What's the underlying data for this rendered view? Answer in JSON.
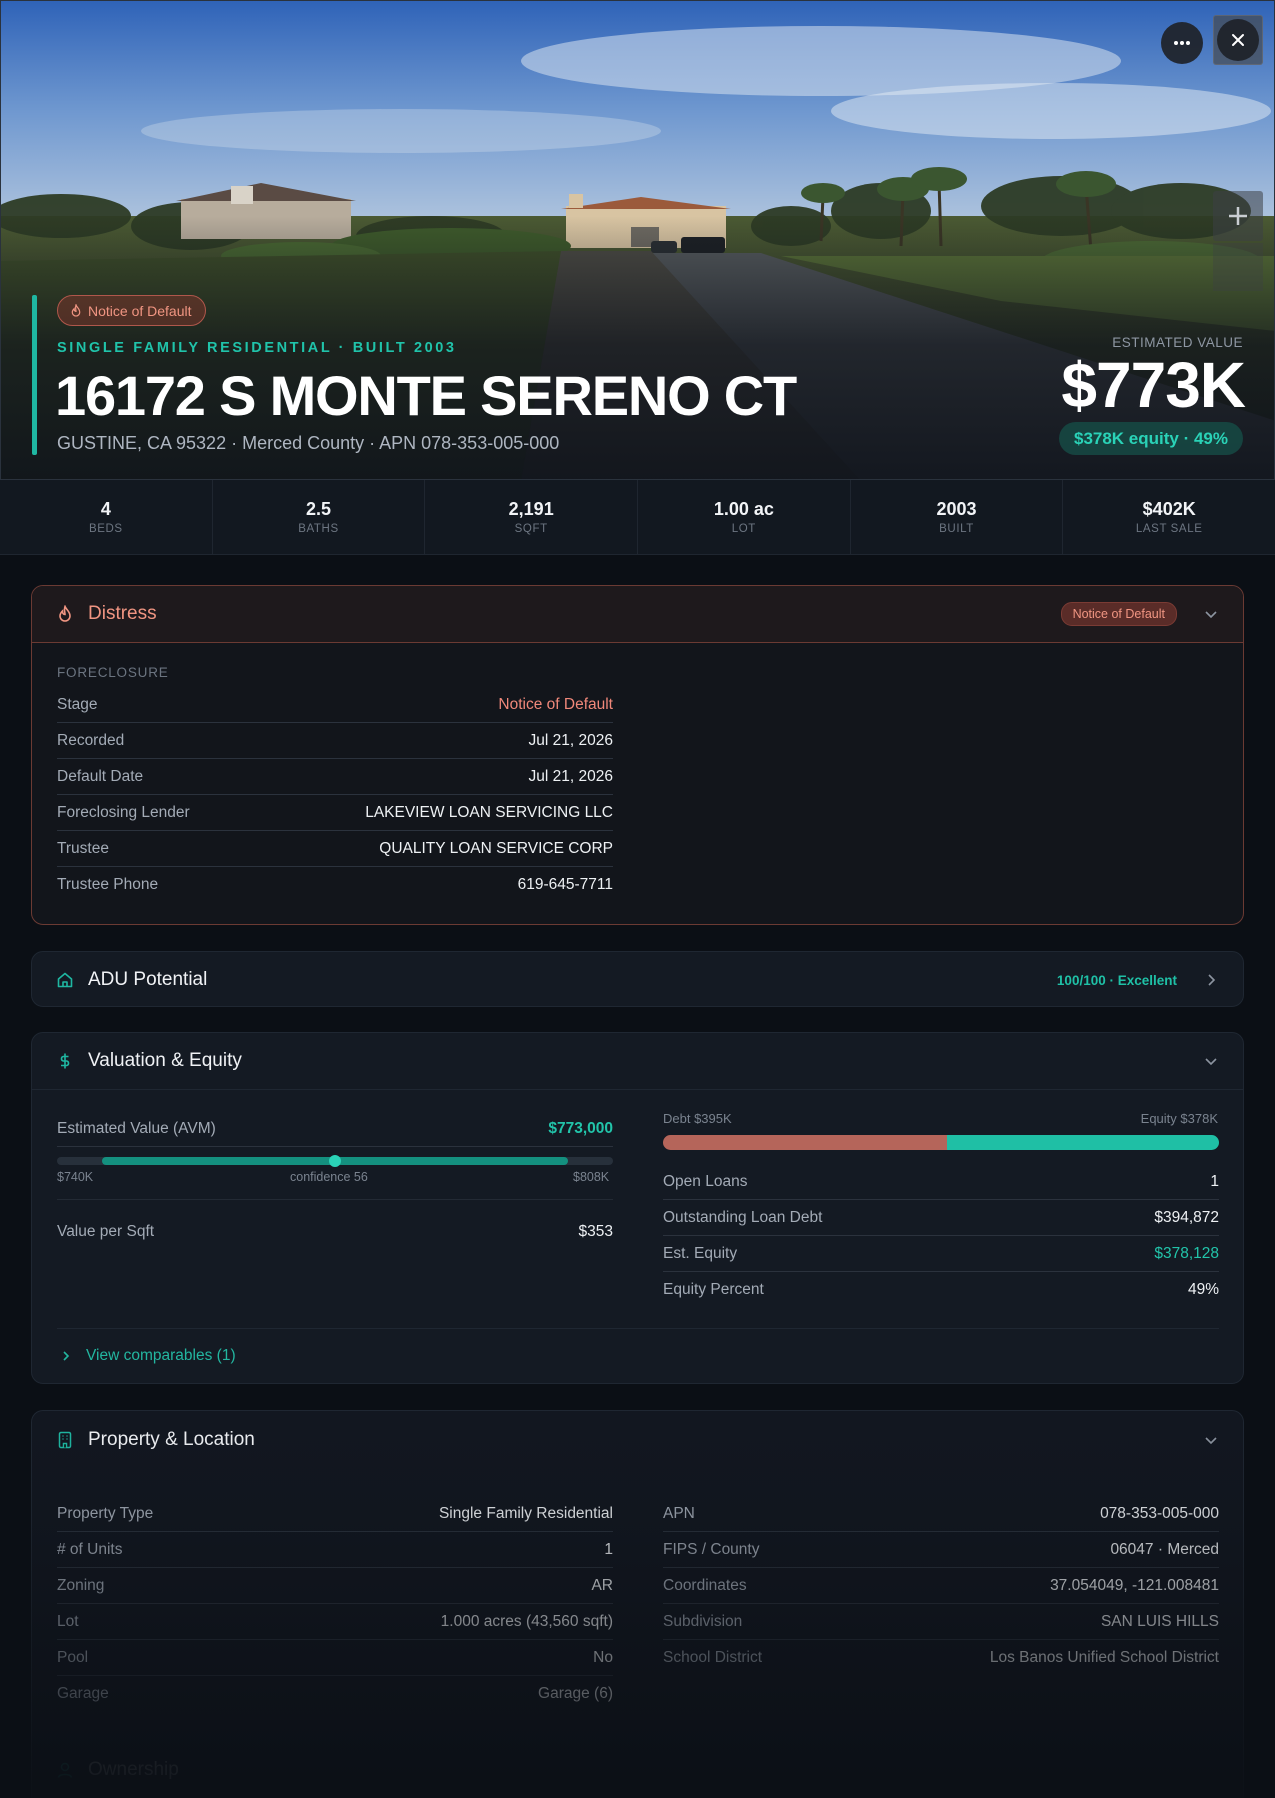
{
  "hero": {
    "badge": "Notice of Default",
    "eyebrow": "SINGLE FAMILY RESIDENTIAL · BUILT 2003",
    "title": "16172 S MONTE SERENO CT",
    "subtitle": "GUSTINE, CA 95322 · Merced County · APN 078-353-005-000",
    "est_label": "ESTIMATED VALUE",
    "est_value": "$773K",
    "equity_pill": "$378K equity · 49%"
  },
  "stats": [
    {
      "value": "4",
      "label": "BEDS"
    },
    {
      "value": "2.5",
      "label": "BATHS"
    },
    {
      "value": "2,191",
      "label": "SQFT"
    },
    {
      "value": "1.00 ac",
      "label": "LOT"
    },
    {
      "value": "2003",
      "label": "BUILT"
    },
    {
      "value": "$402K",
      "label": "LAST SALE"
    }
  ],
  "distress": {
    "title": "Distress",
    "badge": "Notice of Default",
    "section": "FORECLOSURE",
    "rows": [
      {
        "k": "Stage",
        "v": "Notice of Default"
      },
      {
        "k": "Recorded",
        "v": "Jul 21, 2026"
      },
      {
        "k": "Default Date",
        "v": "Jul 21, 2026"
      },
      {
        "k": "Foreclosing Lender",
        "v": "LAKEVIEW LOAN SERVICING LLC"
      },
      {
        "k": "Trustee",
        "v": "QUALITY LOAN SERVICE CORP"
      },
      {
        "k": "Trustee Phone",
        "v": "619-645-7711"
      }
    ]
  },
  "adu": {
    "title": "ADU Potential",
    "score": "100/100 · Excellent"
  },
  "valuation": {
    "title": "Valuation & Equity",
    "avm_label": "Estimated Value (AVM)",
    "avm_value": "$773,000",
    "range_low": "$740K",
    "range_high": "$808K",
    "confidence": "confidence 56",
    "avm_position": 0.5,
    "per_sqft_label": "Value per Sqft",
    "per_sqft_value": "$353",
    "debt_label": "Debt $395K",
    "equity_label": "Equity $378K",
    "debt_fraction": 0.51,
    "rows": [
      {
        "k": "Open Loans",
        "v": "1"
      },
      {
        "k": "Outstanding Loan Debt",
        "v": "$394,872"
      },
      {
        "k": "Est. Equity",
        "v": "$378,128"
      },
      {
        "k": "Equity Percent",
        "v": "49%"
      }
    ],
    "comparables": "View comparables (1)"
  },
  "property": {
    "title": "Property & Location",
    "left": [
      {
        "k": "Property Type",
        "v": "Single Family Residential"
      },
      {
        "k": "# of Units",
        "v": "1"
      },
      {
        "k": "Zoning",
        "v": "AR"
      },
      {
        "k": "Lot",
        "v": "1.000 acres (43,560 sqft)"
      },
      {
        "k": "Pool",
        "v": "No"
      },
      {
        "k": "Garage",
        "v": "Garage (6)"
      }
    ],
    "right": [
      {
        "k": "APN",
        "v": "078-353-005-000"
      },
      {
        "k": "FIPS / County",
        "v": "06047 · Merced"
      },
      {
        "k": "Coordinates",
        "v": "37.054049, -121.008481"
      },
      {
        "k": "Subdivision",
        "v": "SAN LUIS HILLS"
      },
      {
        "k": "School District",
        "v": "Los Banos Unified School District"
      }
    ]
  },
  "ownership": {
    "title": "Ownership"
  },
  "colors": {
    "accent": "#1fb7a2",
    "distress": "#f09582",
    "debt": "#b5655a",
    "equity": "#1fbfa5"
  }
}
